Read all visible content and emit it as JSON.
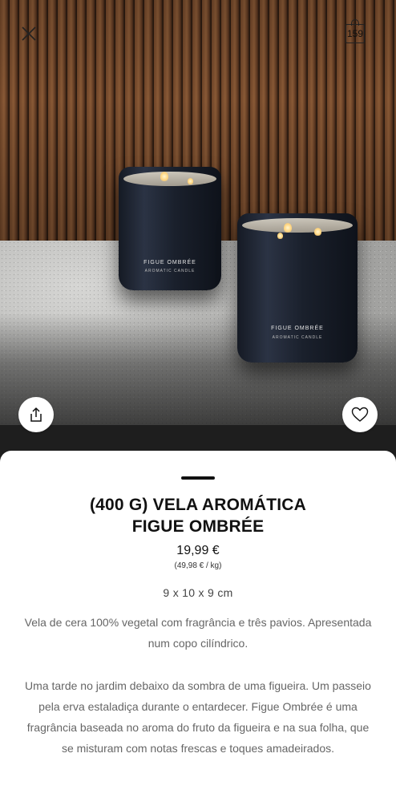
{
  "header": {
    "close_icon": "close-icon",
    "bag_icon": "shopping-bag-icon",
    "bag_count": "159"
  },
  "hero": {
    "image_alt": "Two dark aromatic candles on a grey stone surface",
    "candle_label_line1": "FIGUE OMBRÉE",
    "candle_label_line2": "AROMATIC CANDLE"
  },
  "actions": {
    "share_icon": "share-icon",
    "favorite_icon": "heart-icon"
  },
  "product": {
    "title_line1": "(400 G) VELA AROMÁTICA",
    "title_line2": "FIGUE OMBRÉE",
    "price": "19,99 €",
    "unit_price": "(49,98 € / kg)",
    "dimensions": "9 x 10 x 9 cm",
    "description_line1": "Vela de cera 100% vegetal com fragrância e três pavios. Apresentada num copo cilíndrico.",
    "description_line2": "Uma tarde no jardim debaixo da sombra de uma figueira. Um passeio pela erva estaladiça durante o entardecer. Figue Ombrée é uma fragrância baseada no aroma do fruto da figueira e na sua folha, que se misturam com notas frescas e toques amadeirados."
  },
  "colors": {
    "text_primary": "#111111",
    "text_secondary": "#666666",
    "sheet_background": "#ffffff"
  }
}
